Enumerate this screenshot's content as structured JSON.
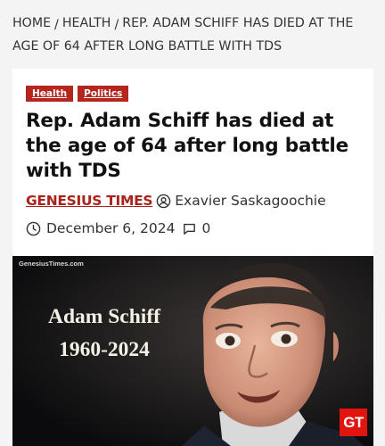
{
  "breadcrumb": {
    "home": "HOME",
    "section": "HEALTH",
    "current": "REP. ADAM SCHIFF HAS DIED AT THE AGE OF 64 AFTER LONG BATTLE WITH TDS",
    "separator": "/"
  },
  "article": {
    "categories": [
      "Health",
      "Politics"
    ],
    "headline": "Rep. Adam Schiff has died at the age of 64 after long battle with TDS",
    "brand": "GENESIUS TIMES",
    "author": "Exavier Saskagoochie",
    "date": "December 6, 2024",
    "comment_count": "0"
  },
  "image": {
    "watermark": "GenesiusTimes.com",
    "name_text": "Adam Schiff",
    "years_text": "1960-2024",
    "logo_text": "GT"
  },
  "colors": {
    "accent": "#b5261e",
    "brand": "#a9221b",
    "logo": "#e3140f"
  },
  "icons": {
    "author": "user-circle-icon",
    "date": "clock-icon",
    "comments": "comment-bubble-icon"
  }
}
